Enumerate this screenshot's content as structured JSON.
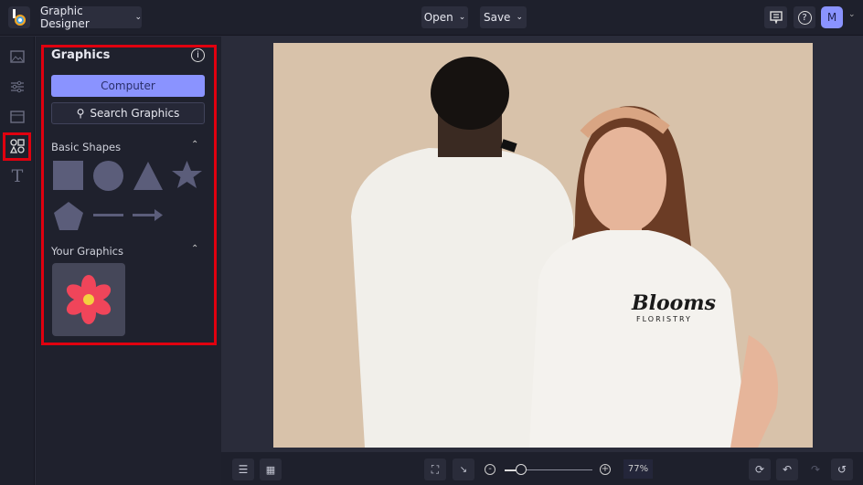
{
  "header": {
    "app_menu": "Graphic Designer",
    "open": "Open",
    "save": "Save",
    "avatar": "M"
  },
  "panel": {
    "title": "Graphics",
    "computer_button": "Computer",
    "search_button": "Search Graphics",
    "basic_shapes": "Basic Shapes",
    "your_graphics": "Your Graphics"
  },
  "canvas": {
    "shirt_logo_line1": "Blooms",
    "shirt_logo_line2": "FLORISTRY"
  },
  "footer": {
    "zoom": "77%"
  },
  "colors": {
    "accent": "#8a93ff",
    "highlight": "#e0000f",
    "flower": "#f0455a"
  }
}
